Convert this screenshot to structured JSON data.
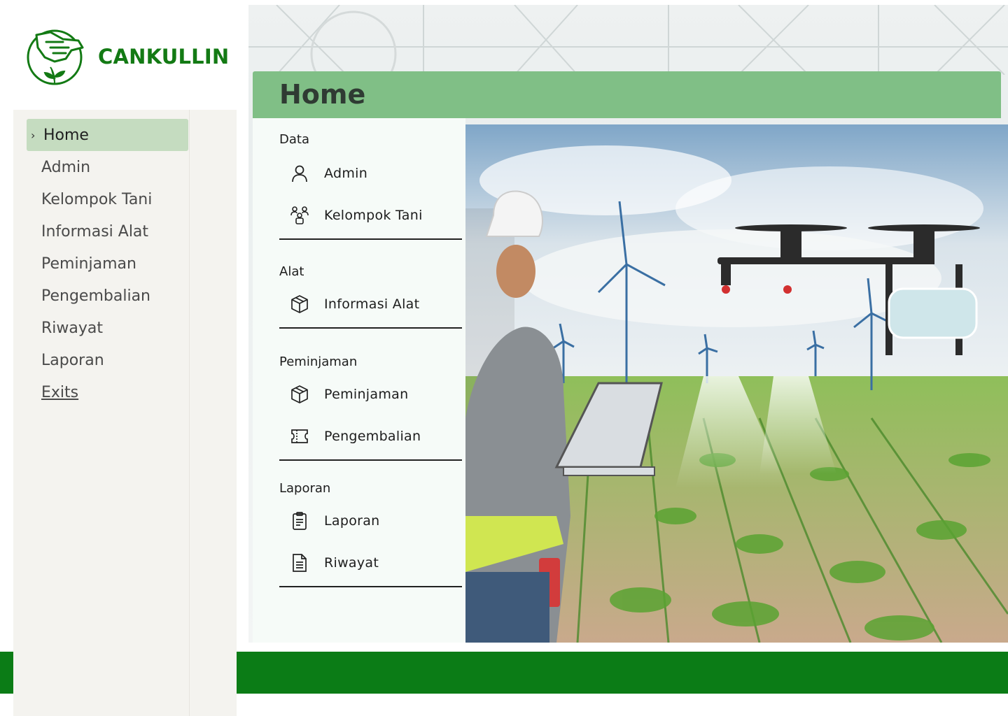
{
  "brand": {
    "name": "CANKULLIN",
    "color": "#137a14",
    "logo_icon": "hand-sprout-logo"
  },
  "sidebar": {
    "items": [
      {
        "label": "Home",
        "active": true
      },
      {
        "label": "Admin"
      },
      {
        "label": "Kelompok Tani"
      },
      {
        "label": "Informasi Alat"
      },
      {
        "label": "Peminjaman"
      },
      {
        "label": "Pengembalian"
      },
      {
        "label": "Riwayat"
      },
      {
        "label": "Laporan"
      },
      {
        "label": "Exits"
      }
    ],
    "active_color": "#c5dcc0"
  },
  "header": {
    "title": "Home",
    "color": "#80bf86"
  },
  "menu": {
    "sections": [
      {
        "title": "Data",
        "items": [
          {
            "label": "Admin",
            "icon": "user-icon"
          },
          {
            "label": "Kelompok Tani",
            "icon": "group-icon"
          }
        ]
      },
      {
        "title": "Alat",
        "items": [
          {
            "label": "Informasi Alat",
            "icon": "box-icon"
          }
        ]
      },
      {
        "title": "Peminjaman",
        "items": [
          {
            "label": "Peminjaman",
            "icon": "box-icon"
          },
          {
            "label": "Pengembalian",
            "icon": "ticket-icon"
          }
        ]
      },
      {
        "title": "Laporan",
        "items": [
          {
            "label": "Laporan",
            "icon": "clipboard-icon"
          },
          {
            "label": "Riwayat",
            "icon": "document-icon"
          }
        ]
      }
    ]
  },
  "hero": {
    "subject": "farmer with laptop controlling drone over corn field with wind turbines"
  },
  "footer": {
    "color": "#0b7c16"
  }
}
